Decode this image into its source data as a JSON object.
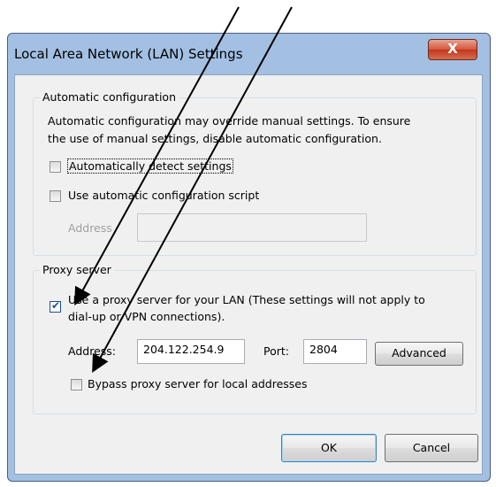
{
  "window": {
    "title": "Local Area Network (LAN) Settings",
    "close_glyph": "X"
  },
  "automatic": {
    "legend": "Automatic configuration",
    "description_line1": "Automatic configuration may override manual settings.  To ensure",
    "description_line2": "the use of manual settings, disable automatic configuration.",
    "detect_settings": {
      "label": "Automatically detect settings",
      "checked": false
    },
    "use_script": {
      "label": "Use automatic configuration script",
      "checked": false
    },
    "address_label": "Address",
    "address_value": ""
  },
  "proxy": {
    "legend": "Proxy server",
    "use_proxy": {
      "label_line1": "Use a proxy server for your LAN (These settings will not apply to",
      "label_line2": "dial-up or VPN connections).",
      "checked": true
    },
    "address_label": "Address:",
    "address_value": "204.122.254.9",
    "port_label": "Port:",
    "port_value": "2804",
    "advanced_label": "Advanced",
    "bypass": {
      "label": "Bypass proxy server for local addresses",
      "checked": false
    }
  },
  "buttons": {
    "ok": "OK",
    "cancel": "Cancel"
  },
  "icons": {
    "check": "check-icon",
    "close": "close-icon"
  },
  "colors": {
    "title_bar": "#a3c0e3",
    "close_button": "#c2361d",
    "dialog_bg": "#f0f0f0"
  }
}
